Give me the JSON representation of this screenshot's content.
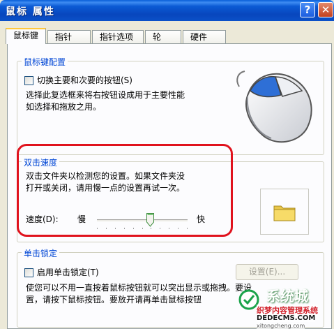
{
  "window": {
    "title": "鼠标 属性",
    "help_btn": "?",
    "close_btn": "✕"
  },
  "tabs": [
    "鼠标键",
    "指针",
    "指针选项",
    "轮",
    "硬件"
  ],
  "button_config": {
    "legend": "鼠标键配置",
    "switch_label": "切换主要和次要的按钮(S)",
    "switch_checked": false,
    "description": [
      "选择此复选框来将右按钮设成用于主要性能",
      "如选择和拖放之用。"
    ]
  },
  "double_click": {
    "legend": "双击速度",
    "description": [
      "双击文件夹以检测您的设置。如果文件夹没",
      "打开或关闭，请用慢一点的设置再试一次。"
    ],
    "speed_label": "速度(D):",
    "slow_label": "慢",
    "fast_label": "快",
    "speed_level": 0.6
  },
  "click_lock": {
    "legend": "单击锁定",
    "enable_label": "启用单击锁定(T)",
    "enable_checked": false,
    "settings_button": "设置(E)...",
    "description": [
      "使您可以不用一直按着鼠标按钮就可以突出显示或拖拽。要设",
      "置，请按下鼠标按钮。要放开请再单击鼠标按钮"
    ]
  },
  "watermark": {
    "brand": "系统城",
    "line1": "织梦内容管理系统",
    "line2": "DEDECMS.COM",
    "line3": "xitongcheng.com"
  },
  "colors": {
    "highlight_border": "#e0121d",
    "legend_text": "#0046d5",
    "titlebar": "#0b51c8"
  }
}
